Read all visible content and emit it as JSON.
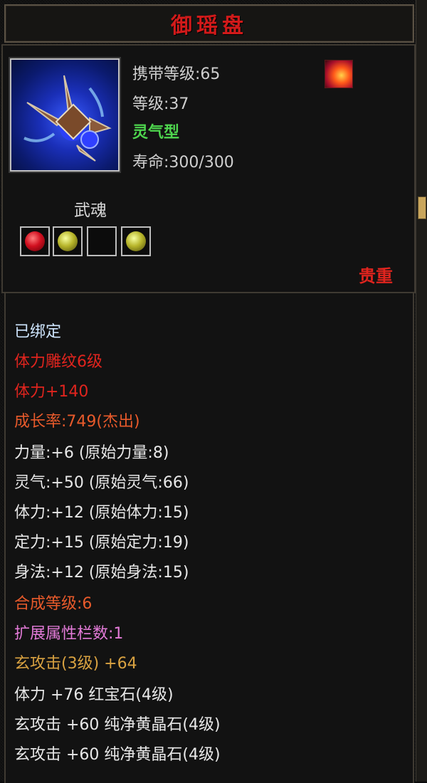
{
  "title": "御瑶盘",
  "pet": {
    "carry_level": "携带等级:65",
    "level": "等级:37",
    "type": "灵气型",
    "lifespan": "寿命:300/300"
  },
  "wuhun": {
    "label": "武魂",
    "slots": [
      "red-gem",
      "yellow-gem",
      "empty",
      "yellow-gem"
    ]
  },
  "rarity": "贵重",
  "details": [
    {
      "text": "已绑定",
      "color": "#cfe6ff"
    },
    {
      "text": "体力雕纹6级",
      "color": "#e0241e"
    },
    {
      "text": "体力+140",
      "color": "#e0241e"
    },
    {
      "text": "成长率:749(杰出)",
      "color": "#e85a2b"
    },
    {
      "text": "力量:+6  (原始力量:8)",
      "color": "#e8e8e8"
    },
    {
      "text": "灵气:+50  (原始灵气:66)",
      "color": "#e8e8e8"
    },
    {
      "text": "体力:+12  (原始体力:15)",
      "color": "#e8e8e8"
    },
    {
      "text": "定力:+15  (原始定力:19)",
      "color": "#e8e8e8"
    },
    {
      "text": "身法:+12  (原始身法:15)",
      "color": "#e8e8e8"
    },
    {
      "text": "合成等级:6",
      "color": "#e85a2b"
    },
    {
      "text": "扩展属性栏数:1",
      "color": "#e37bd8"
    },
    {
      "text": "玄攻击(3级)  +64",
      "color": "#d9a241"
    },
    {
      "text": "体力  +76  红宝石(4级)",
      "color": "#e8e8e8"
    },
    {
      "text": "玄攻击  +60  纯净黄晶石(4级)",
      "color": "#e8e8e8"
    },
    {
      "text": "玄攻击  +60  纯净黄晶石(4级)",
      "color": "#e8e8e8"
    }
  ],
  "icons": {
    "pet_icon": "spinning-shuriken-orb-icon",
    "element_icon": "flame-icon"
  }
}
